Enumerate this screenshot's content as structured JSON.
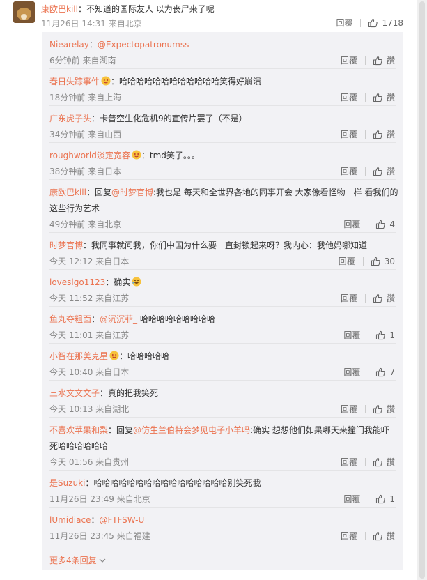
{
  "root": {
    "user": "康欧巴kill",
    "colon": "：",
    "text": "不知道的国际友人 以为丧尸来了呢",
    "time": "11月26日 14:31",
    "location": "来自北京",
    "reply_label": "回覆",
    "likes": "1718"
  },
  "replies": [
    {
      "user": "Niearelay",
      "sep": "：",
      "mention": "@Expectopatronumss",
      "text": "",
      "time": "6分钟前",
      "location": "来自湖南",
      "reply_label": "回覆",
      "like_label": "讚",
      "likes": ""
    },
    {
      "user": "春日失踪事件",
      "sep": "：",
      "mention": "",
      "text": "哈哈哈哈哈哈哈哈哈哈哈哈笑得好崩溃",
      "time": "18分钟前",
      "location": "来自上海",
      "reply_label": "回覆",
      "like_label": "讚",
      "likes": ""
    },
    {
      "user": "广东虎子头",
      "sep": "：",
      "mention": "",
      "text": "卡普空生化危机9的宣传片罢了（不是）",
      "time": "34分钟前",
      "location": "来自山西",
      "reply_label": "回覆",
      "like_label": "讚",
      "likes": ""
    },
    {
      "user": "roughworld淡定宽容",
      "sep": "：",
      "mention": "",
      "text": "tmd笑了。。。",
      "time": "38分钟前",
      "location": "来自日本",
      "reply_label": "回覆",
      "like_label": "讚",
      "likes": ""
    },
    {
      "user": "康欧巴kill",
      "sep": "：",
      "prefix": "回复",
      "mention": "@时梦官博",
      "text": ":我也是 每天和全世界各地的同事开会 大家像看怪物一样 看我们的",
      "text2": "这些行为艺术",
      "time": "49分钟前",
      "location": "来自北京",
      "reply_label": "回覆",
      "like_label": "",
      "likes": "4"
    },
    {
      "user": "时梦官博",
      "sep": "：",
      "mention": "",
      "text": "我同事就问我，你们中国为什么要一直封锁起来呀？我内心：我他妈哪知道",
      "time": "今天 12:12",
      "location": "来自日本",
      "reply_label": "回覆",
      "like_label": "",
      "likes": "30"
    },
    {
      "user": "loveslgo1123",
      "sep": "：",
      "mention": "",
      "text": "确实",
      "time": "今天 11:52",
      "location": "来自江苏",
      "reply_label": "回覆",
      "like_label": "讚",
      "likes": ""
    },
    {
      "user": "鱼丸夺粗面",
      "sep": "：",
      "mention": "@沉沉菲_",
      "text": " 哈哈哈哈哈哈哈哈哈",
      "time": "今天 11:01",
      "location": "来自江苏",
      "reply_label": "回覆",
      "like_label": "",
      "likes": "1"
    },
    {
      "user": "小智在那美克星",
      "sep": "：",
      "mention": "",
      "text": "哈哈哈哈哈",
      "time": "今天 10:40",
      "location": "来自日本",
      "reply_label": "回覆",
      "like_label": "",
      "likes": "7"
    },
    {
      "user": "三水文文文子",
      "sep": "：",
      "mention": "",
      "text": "真的把我笑死",
      "time": "今天 10:13",
      "location": "来自湖北",
      "reply_label": "回覆",
      "like_label": "讚",
      "likes": ""
    },
    {
      "user": "不喜欢苹果和梨",
      "sep": "：",
      "prefix": "回复",
      "mention": "@仿生兰伯特会梦见电子小羊吗",
      "text": ":确实 想想他们如果哪天来撞门我能吓",
      "text2": "死哈哈哈哈哈哈",
      "time": "今天 01:56",
      "location": "来自贵州",
      "reply_label": "回覆",
      "like_label": "讚",
      "likes": ""
    },
    {
      "user": "是Suzuki",
      "sep": "：",
      "mention": "",
      "text": "哈哈哈哈哈哈哈哈哈哈哈哈哈哈哈哈别笑死我",
      "time": "11月26日 23:49",
      "location": "来自北京",
      "reply_label": "回覆",
      "like_label": "",
      "likes": "1"
    },
    {
      "user": "lUmidiace",
      "sep": "：",
      "mention": "@FTFSW-U",
      "text": "",
      "time": "11月26日 23:45",
      "location": "来自福建",
      "reply_label": "回覆",
      "like_label": "讚",
      "likes": ""
    }
  ],
  "more_replies": "更多4条回复",
  "colors": {
    "accent": "#eb7350",
    "meta": "#888888",
    "panel": "#f2f2f5"
  }
}
